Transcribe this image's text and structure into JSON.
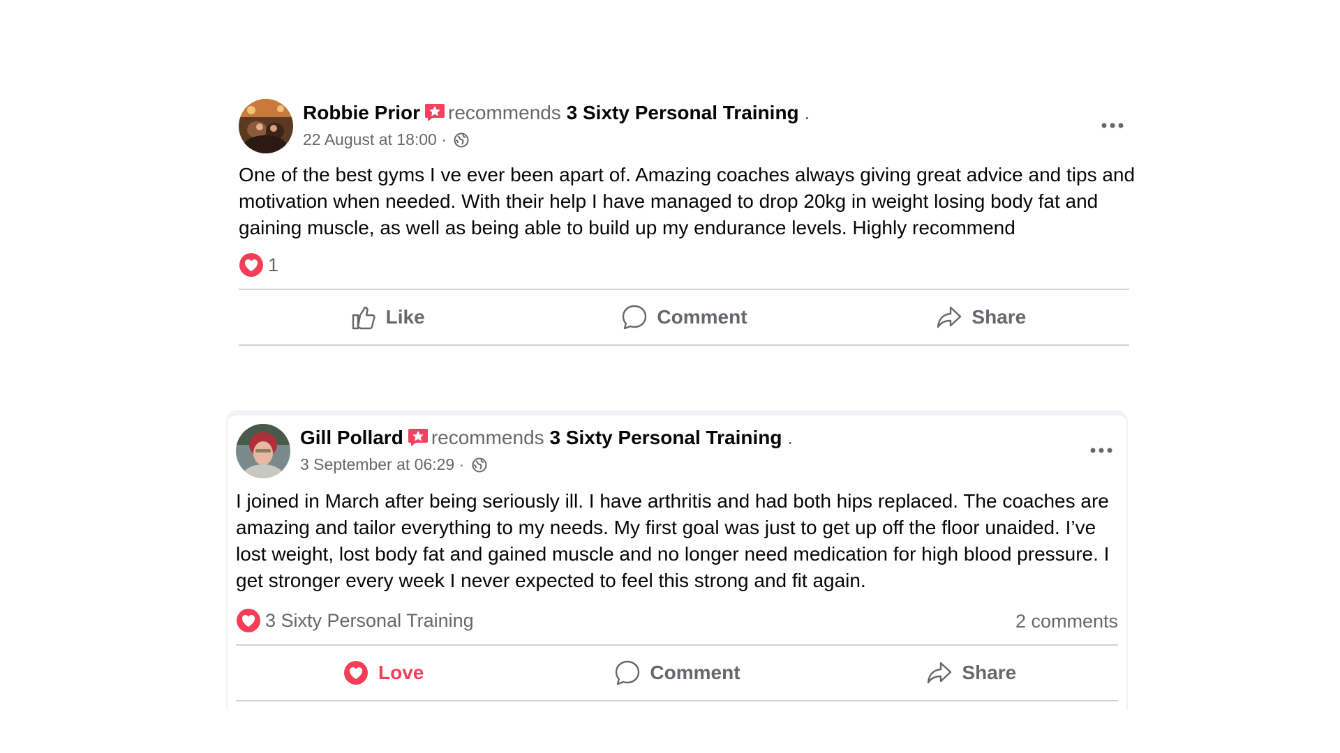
{
  "colors": {
    "text_primary": "#050505",
    "text_secondary": "#65676b",
    "love_red": "#f33e58",
    "divider": "#ced0d4",
    "recommend_badge": "#f3425f"
  },
  "posts": [
    {
      "author": "Robbie Prior",
      "recommends_text": "recommends",
      "page_name": "3 Sixty Personal Training",
      "trailing": ".",
      "timestamp": "22 August at 18:00 ·",
      "audience_icon": "globe-icon",
      "body": "One of the best gyms I ve ever been apart of. Amazing coaches always giving great advice and tips and motivation when needed. With their help I have managed to drop 20kg in weight losing body fat and gaining muscle, as well as being able to build up my endurance levels. Highly recommend",
      "reaction_count": "1",
      "comments": "",
      "actions": {
        "like": "Like",
        "comment": "Comment",
        "share": "Share"
      }
    },
    {
      "author": "Gill Pollard",
      "recommends_text": "recommends",
      "page_name": "3 Sixty Personal Training",
      "trailing": ".",
      "timestamp": "3 September at 06:29 ·",
      "audience_icon": "globe-icon",
      "body": "I joined in March after being seriously ill. I have arthritis and had both hips replaced. The coaches are amazing and tailor everything to my needs. My first goal was just to get up off the floor unaided. I’ve lost weight, lost body fat and gained muscle and no longer need medication for high blood pressure. I get stronger every week I never expected to feel this strong and fit again.",
      "reaction_by": "3 Sixty Personal Training",
      "comments": "2 comments",
      "actions": {
        "love": "Love",
        "comment": "Comment",
        "share": "Share"
      }
    }
  ]
}
